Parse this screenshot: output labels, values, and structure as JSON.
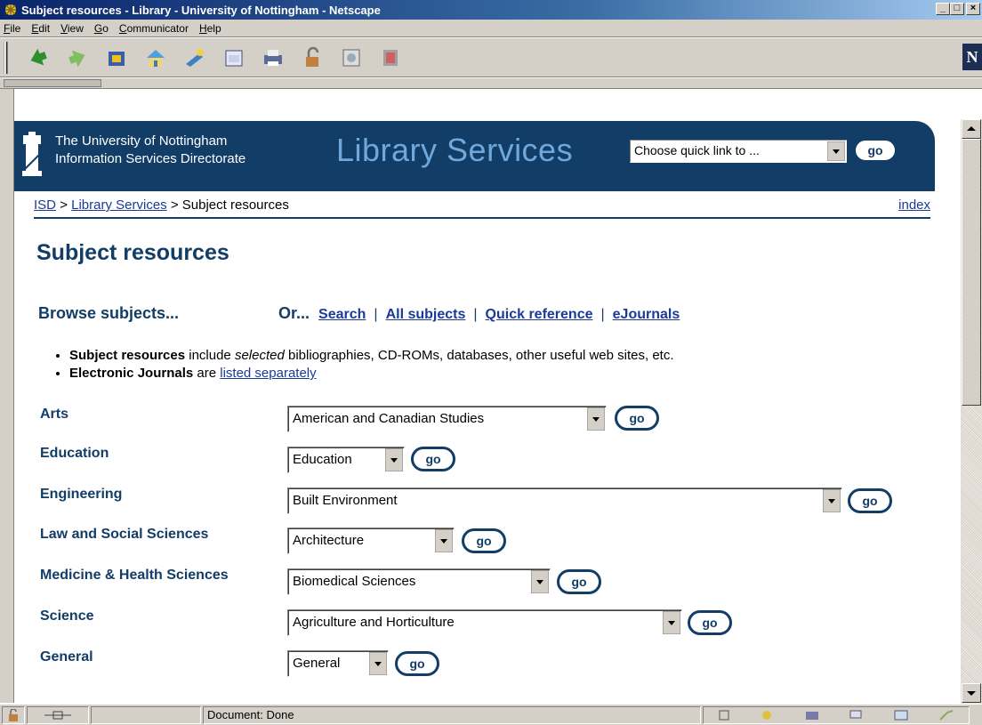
{
  "window": {
    "title": "Subject resources - Library - University of Nottingham - Netscape"
  },
  "menu": [
    "File",
    "Edit",
    "View",
    "Go",
    "Communicator",
    "Help"
  ],
  "toolbar_icons": [
    "back-icon",
    "forward-icon",
    "reload-icon",
    "home-icon",
    "search-icon",
    "mynetscape-icon",
    "print-icon",
    "security-icon",
    "shop-icon",
    "stop-icon"
  ],
  "header": {
    "uni_line1": "The University of Nottingham",
    "uni_line2": "Information Services Directorate",
    "brand": "Library Services",
    "quick_link": "Choose quick link to ...",
    "go": "go"
  },
  "breadcrumb": {
    "isd": "ISD",
    "sep1": ">",
    "library": "Library Services",
    "sep2": ">",
    "current": "Subject resources",
    "index": "index"
  },
  "page": {
    "title": "Subject resources",
    "browse": "Browse subjects...",
    "or": "Or...",
    "links": [
      "Search",
      "All subjects",
      "Quick reference",
      "eJournals"
    ],
    "notes": {
      "n1_bold": "Subject resources",
      "n1_a": " include ",
      "n1_em": "selected",
      "n1_b": " bibliographies, CD-ROMs, databases, other useful web sites, etc.",
      "n2_bold": "Electronic Journals",
      "n2_a": " are ",
      "n2_link": "listed separately"
    }
  },
  "subjects": [
    {
      "label": "Arts",
      "selected": "American and Canadian Studies"
    },
    {
      "label": "Education",
      "selected": "Education"
    },
    {
      "label": "Engineering",
      "selected": "Built Environment"
    },
    {
      "label": "Law and Social Sciences",
      "selected": "Architecture"
    },
    {
      "label": "Medicine & Health Sciences",
      "selected": "Biomedical Sciences"
    },
    {
      "label": "Science",
      "selected": "Agriculture and Horticulture"
    },
    {
      "label": "General",
      "selected": "General"
    }
  ],
  "status": {
    "text": "Document: Done"
  },
  "colors": {
    "brand_navy": "#123d66",
    "brand_light": "#6fa8dc",
    "link": "#1a3a99",
    "chrome": "#d4d0c8"
  }
}
